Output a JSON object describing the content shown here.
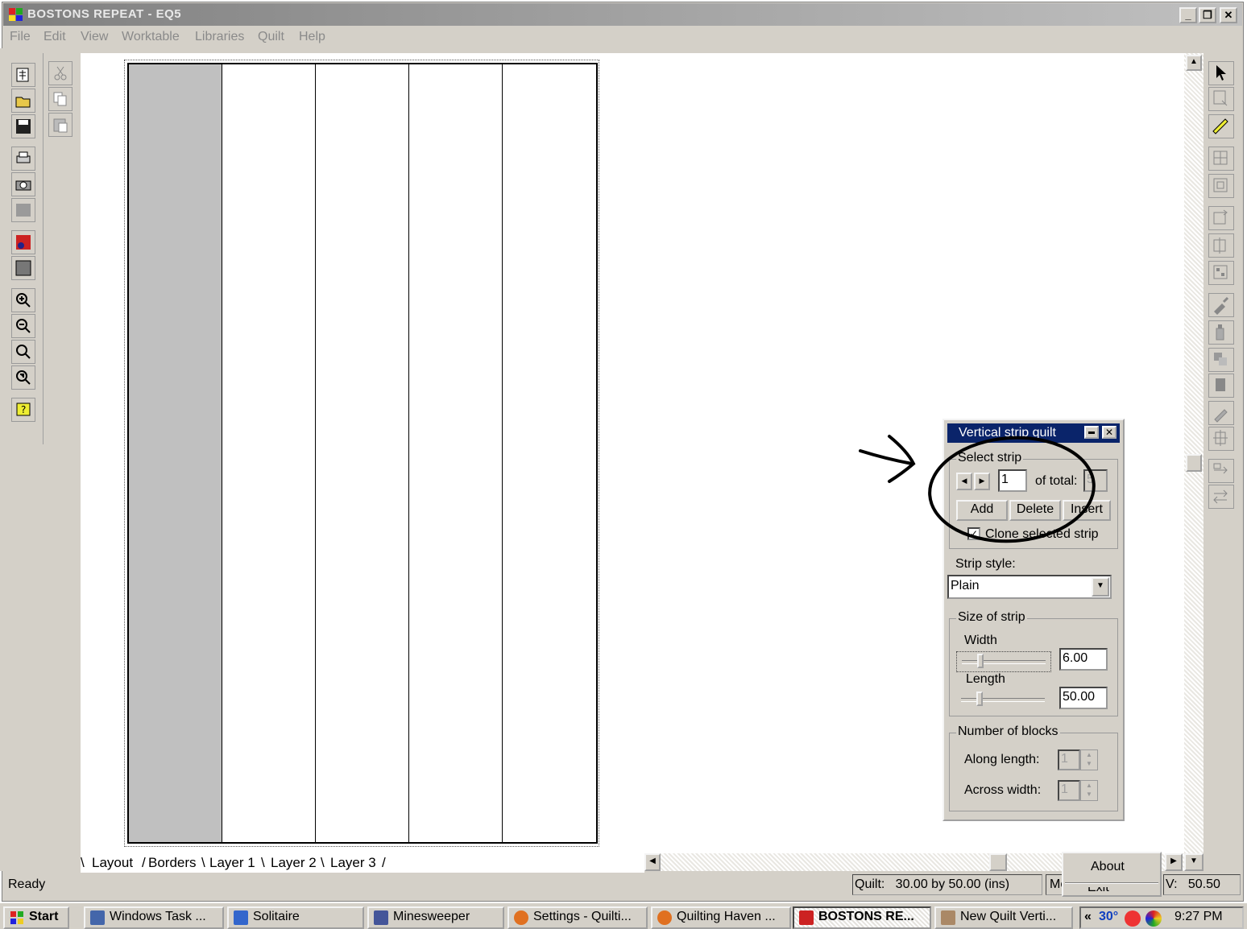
{
  "window": {
    "title": "BOSTONS REPEAT - EQ5",
    "buttons": {
      "minimize": "_",
      "restore": "❐",
      "close": "✕"
    }
  },
  "menu": [
    "File",
    "Edit",
    "View",
    "Worktable",
    "Libraries",
    "Quilt",
    "Help"
  ],
  "quilt": {
    "strip_count": 5,
    "selected_strip_index": 0,
    "selected_color": "#c0c0c0"
  },
  "tabs": [
    "Layout",
    "Borders",
    "Layer 1",
    "Layer 2",
    "Layer 3"
  ],
  "status": {
    "ready": "Ready",
    "quilt_size": "Quilt:   30.00 by 50.00 (ins)",
    "m_partial": "Mc",
    "v_value": "V:   50.50"
  },
  "popup_menu": {
    "about": "About",
    "exit_partial": "Exit"
  },
  "panel": {
    "title": "Vertical strip quilt",
    "select_strip": {
      "label": "Select strip",
      "current": "1",
      "of_total_label": "of total:",
      "total": "5",
      "add": "Add",
      "delete": "Delete",
      "insert": "Insert",
      "clone_label": "Clone selected strip",
      "clone_checked": true
    },
    "strip_style": {
      "label": "Strip style:",
      "value": "Plain"
    },
    "size": {
      "label": "Size of strip",
      "width_label": "Width",
      "width_value": "6.00",
      "width_level": 0.2,
      "length_label": "Length",
      "length_value": "50.00",
      "length_level": 0.2
    },
    "blocks": {
      "label": "Number of blocks",
      "along_label": "Along length:",
      "along_value": "1",
      "across_label": "Across width:",
      "across_value": "1"
    }
  },
  "taskbar": {
    "start": "Start",
    "items": [
      {
        "label": "Windows Task ...",
        "icon": "task-manager-icon",
        "active": false
      },
      {
        "label": "Solitaire",
        "icon": "solitaire-icon",
        "active": false
      },
      {
        "label": "Minesweeper",
        "icon": "minesweeper-icon",
        "active": false
      },
      {
        "label": "Settings - Quilti...",
        "icon": "firefox-icon",
        "active": false
      },
      {
        "label": "Quilting Haven ...",
        "icon": "firefox-icon",
        "active": false
      },
      {
        "label": "BOSTONS RE...",
        "icon": "eq5-icon",
        "active": true
      },
      {
        "label": "New Quilt  Verti...",
        "icon": "eq5-wizard-icon",
        "active": false
      }
    ],
    "tray": {
      "chevron": "«",
      "temperature": "30°",
      "clock": "9:27 PM"
    }
  }
}
